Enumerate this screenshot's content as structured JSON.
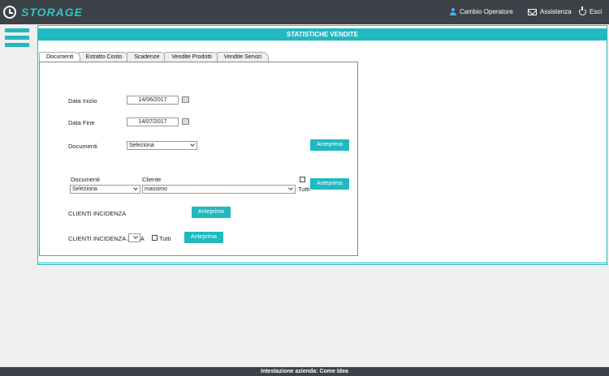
{
  "app": {
    "logo_text": "STORAGE"
  },
  "topbar": {
    "cambio_operatore": "Cambio Operatore",
    "assistenza": "Assistenza",
    "esci": "Esci"
  },
  "panel": {
    "title": "STATISTICHE VENDITE"
  },
  "tabs": [
    {
      "label": "Documenti",
      "active": true
    },
    {
      "label": "Estratto Conto"
    },
    {
      "label": "Scadenze"
    },
    {
      "label": "Vendite Prodotti"
    },
    {
      "label": "Vendite Servizi"
    }
  ],
  "form": {
    "data_inizio_label": "Data Inizio",
    "data_inizio_value": "14/06/2017",
    "data_fine_label": "Data Fine",
    "data_fine_value": "14/07/2017",
    "documenti_label": "Documenti",
    "documenti_select": "Seleziona",
    "anteprima_label": "Anteprima",
    "documenti2_label": "Documenti",
    "cliente_label": "Cliente",
    "documenti2_select": "Seleziona",
    "cliente_select": "massimo",
    "tutti_label": "Tutti",
    "clienti_incidenza_label": "CLIENTI INCIDENZA",
    "clienti_incidenza_zona_label": "CLIENTI INCIDENZA ZONA",
    "zona_tutti_label": "Tutti"
  },
  "footer": {
    "text": "Intestazione azienda: Come Idea"
  },
  "colors": {
    "accent": "#1fb9bf",
    "topbar": "#3d4248"
  }
}
